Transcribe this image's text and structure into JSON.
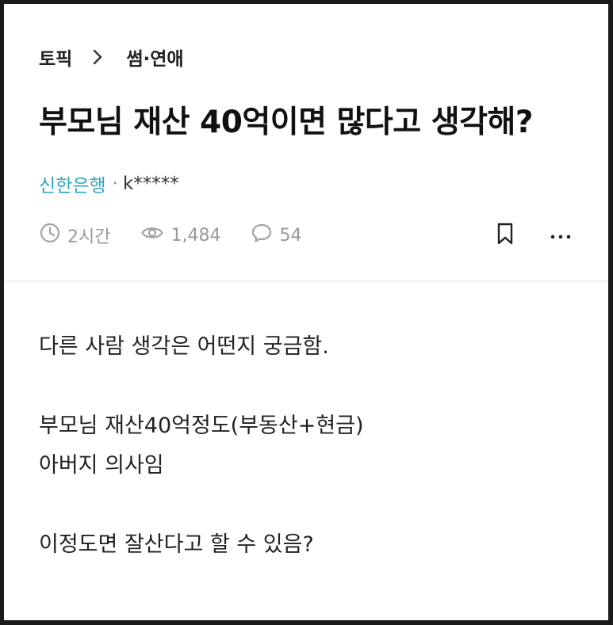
{
  "breadcrumb": {
    "root": "토픽",
    "category": "썸·연애"
  },
  "post": {
    "title": "부모님 재산 40억이면 많다고 생각해?",
    "company": "신한은행",
    "separator": "·",
    "author": "k*****",
    "time": "2시간",
    "views": "1,484",
    "comments": "54"
  },
  "body": {
    "line1": "다른 사람 생각은 어떤지 궁금함.",
    "line2": "부모님 재산40억정도(부동산+현금)",
    "line3": "아버지 의사임",
    "line4": "이정도면 잘산다고 할 수 있음?"
  },
  "icons": {
    "breadcrumb_separator": "chevron-right-icon",
    "time": "clock-icon",
    "views": "eye-icon",
    "comments": "comment-bubble-icon",
    "bookmark": "bookmark-icon",
    "more": "more-horizontal-icon"
  },
  "colors": {
    "company_accent": "#2ba9c6",
    "meta_gray": "#999999",
    "text_dark": "#111111"
  }
}
